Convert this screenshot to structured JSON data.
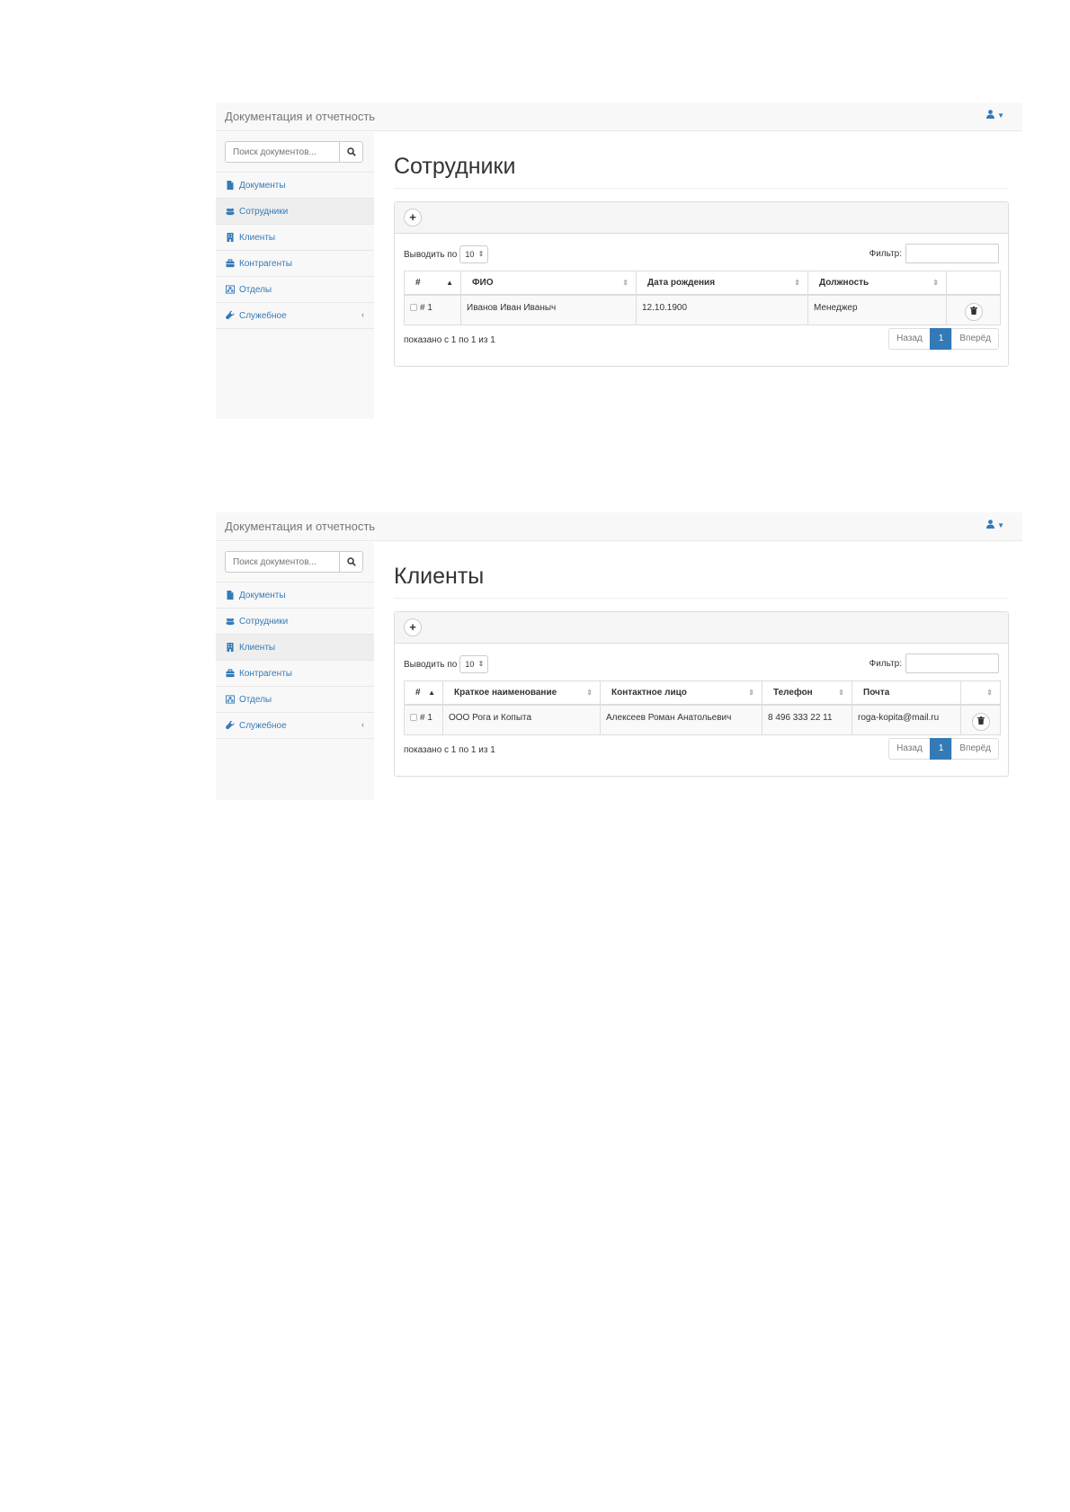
{
  "colors": {
    "link": "#337ab7",
    "navbar_bg": "#f8f8f8",
    "active_page": "#337ab7",
    "border": "#dddddd"
  },
  "screens": [
    {
      "brand": "Документация и отчетность",
      "search": {
        "placeholder": "Поиск документов..."
      },
      "nav": [
        {
          "label": "Документы",
          "icon": "file-icon"
        },
        {
          "label": "Сотрудники",
          "icon": "users-icon"
        },
        {
          "label": "Клиенты",
          "icon": "building-icon"
        },
        {
          "label": "Контрагенты",
          "icon": "briefcase-icon"
        },
        {
          "label": "Отделы",
          "icon": "sitemap-icon"
        },
        {
          "label": "Служебное",
          "icon": "wrench-icon",
          "arrow": "‹"
        }
      ],
      "active_nav": "Сотрудники",
      "title": "Сотрудники",
      "add_label": "+",
      "length": {
        "label": "Выводить по",
        "value": "10"
      },
      "filter_label": "Фильтр:",
      "table": {
        "headers": [
          "#",
          "ФИО",
          "Дата рождения",
          "Должность",
          ""
        ],
        "rows": [
          {
            "id": "# 1",
            "cells": [
              "Иванов Иван Иваныч",
              "12.10.1900",
              "Менеджер"
            ]
          }
        ]
      },
      "info": "показано с 1 по 1 из 1",
      "pager": {
        "prev": "Назад",
        "current": "1",
        "next": "Вперёд"
      }
    },
    {
      "brand": "Документация и отчетность",
      "search": {
        "placeholder": "Поиск документов..."
      },
      "nav": [
        {
          "label": "Документы",
          "icon": "file-icon"
        },
        {
          "label": "Сотрудники",
          "icon": "users-icon"
        },
        {
          "label": "Клиенты",
          "icon": "building-icon"
        },
        {
          "label": "Контрагенты",
          "icon": "briefcase-icon"
        },
        {
          "label": "Отделы",
          "icon": "sitemap-icon"
        },
        {
          "label": "Служебное",
          "icon": "wrench-icon",
          "arrow": "‹"
        }
      ],
      "active_nav": "Клиенты",
      "title": "Клиенты",
      "add_label": "+",
      "length": {
        "label": "Выводить по",
        "value": "10"
      },
      "filter_label": "Фильтр:",
      "table": {
        "headers": [
          "#",
          "Краткое наименование",
          "Контактное лицо",
          "Телефон",
          "Почта",
          ""
        ],
        "rows": [
          {
            "id": "# 1",
            "cells": [
              "ООО Рога и Копыта",
              "Алексеев Роман Анатольевич",
              "8 496 333 22 11",
              "roga-kopita@mail.ru"
            ]
          }
        ]
      },
      "info": "показано с 1 по 1 из 1",
      "pager": {
        "prev": "Назад",
        "current": "1",
        "next": "Вперёд"
      }
    }
  ]
}
